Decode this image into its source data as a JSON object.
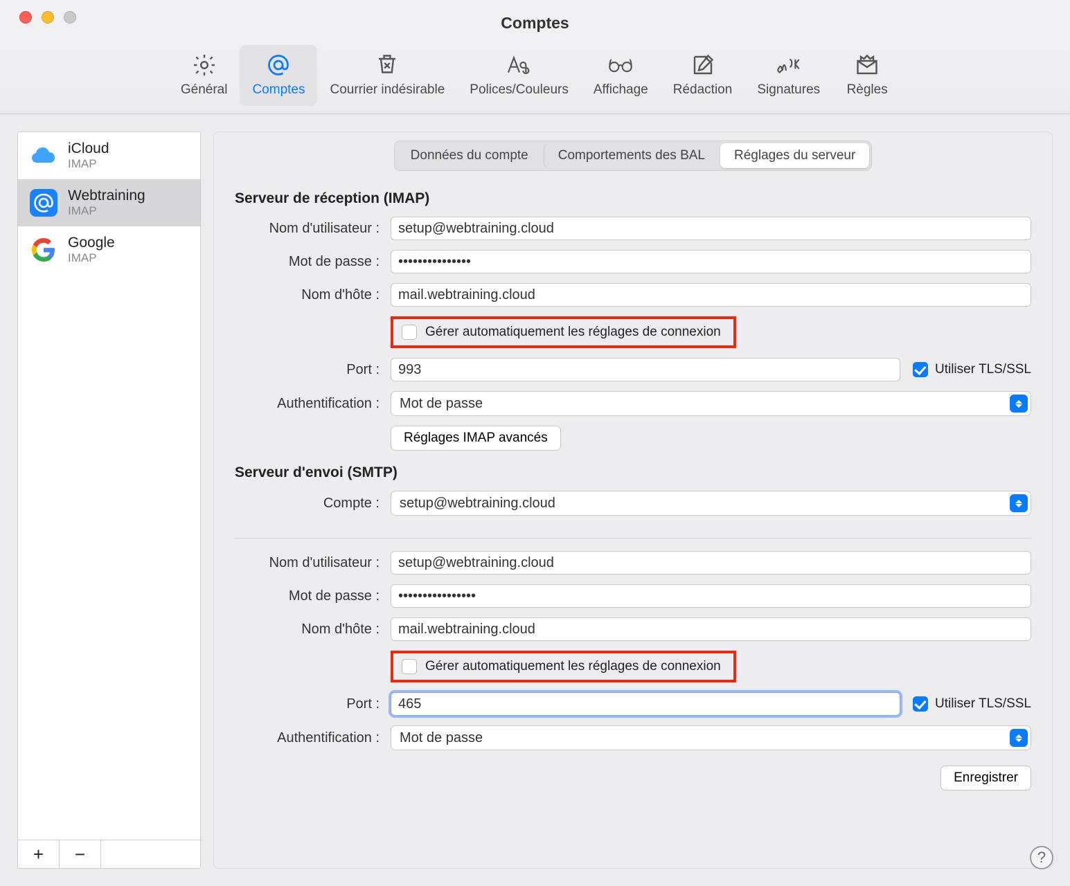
{
  "window": {
    "title": "Comptes"
  },
  "toolbar": {
    "items": [
      {
        "label": "Général"
      },
      {
        "label": "Comptes"
      },
      {
        "label": "Courrier indésirable"
      },
      {
        "label": "Polices/Couleurs"
      },
      {
        "label": "Affichage"
      },
      {
        "label": "Rédaction"
      },
      {
        "label": "Signatures"
      },
      {
        "label": "Règles"
      }
    ]
  },
  "sidebar": {
    "accounts": [
      {
        "name": "iCloud",
        "protocol": "IMAP"
      },
      {
        "name": "Webtraining",
        "protocol": "IMAP"
      },
      {
        "name": "Google",
        "protocol": "IMAP"
      }
    ],
    "add": "+",
    "remove": "−"
  },
  "tabs": {
    "items": [
      "Données du compte",
      "Comportements des BAL",
      "Réglages du serveur"
    ]
  },
  "incoming": {
    "section": "Serveur de réception (IMAP)",
    "username_label": "Nom d'utilisateur :",
    "username": "setup@webtraining.cloud",
    "password_label": "Mot de passe :",
    "password": "•••••••••••••••",
    "host_label": "Nom d'hôte :",
    "host": "mail.webtraining.cloud",
    "auto_label": "Gérer automatiquement les réglages de connexion",
    "port_label": "Port :",
    "port": "993",
    "tls_label": "Utiliser TLS/SSL",
    "auth_label": "Authentification :",
    "auth_value": "Mot de passe",
    "advanced_btn": "Réglages IMAP avancés"
  },
  "outgoing": {
    "section": "Serveur d'envoi (SMTP)",
    "account_label": "Compte :",
    "account_value": "setup@webtraining.cloud",
    "username_label": "Nom d'utilisateur :",
    "username": "setup@webtraining.cloud",
    "password_label": "Mot de passe :",
    "password": "••••••••••••••••",
    "host_label": "Nom d'hôte :",
    "host": "mail.webtraining.cloud",
    "auto_label": "Gérer automatiquement les réglages de connexion",
    "port_label": "Port :",
    "port": "465",
    "tls_label": "Utiliser TLS/SSL",
    "auth_label": "Authentification :",
    "auth_value": "Mot de passe"
  },
  "save_btn": "Enregistrer",
  "help": "?"
}
